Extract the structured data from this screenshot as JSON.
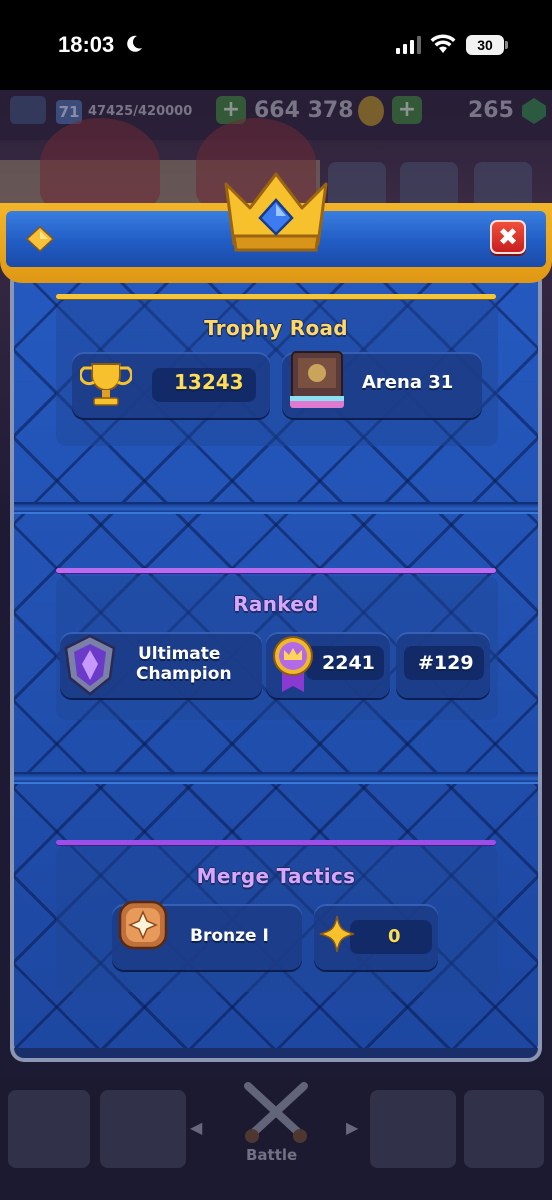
{
  "status_bar": {
    "time": "18:03",
    "battery": "30"
  },
  "background": {
    "level": "71",
    "xp": "47425/420000",
    "gold": "664 378",
    "gems": "265",
    "plus": "+",
    "nav_battle_label": "Battle"
  },
  "modal": {
    "close_label": "✖",
    "trophy_road": {
      "title": "Trophy Road",
      "trophies": "13243",
      "arena": "Arena 31"
    },
    "ranked": {
      "title": "Ranked",
      "league_line1": "Ultimate",
      "league_line2": "Champion",
      "rating": "2241",
      "rank": "#129"
    },
    "merge_tactics": {
      "title": "Merge Tactics",
      "league": "Bronze I",
      "points": "0"
    }
  },
  "colors": {
    "panel_blue": "#1f4aa3",
    "header_gold": "#f2b52a",
    "title_gold": "#ffd86a",
    "title_purple": "#d8a6ff",
    "close_red": "#e03a2a"
  },
  "icons": [
    "moon-icon",
    "signal-icon",
    "wifi-icon",
    "crown-icon",
    "diamond-icon",
    "close-icon",
    "trophy-icon",
    "arena-icon",
    "league-shield-icon",
    "rating-medal-icon",
    "bronze-badge-icon",
    "star-icon",
    "swords-icon"
  ]
}
